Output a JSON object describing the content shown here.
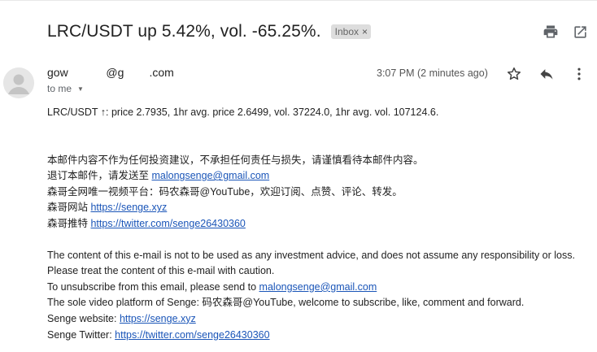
{
  "email": {
    "subject": "LRC/USDT up 5.42%, vol. -65.25%.",
    "label_chip": "Inbox",
    "label_chip_close": "×",
    "sender": "gow            @g        .com",
    "recipient": "to me",
    "timestamp": "3:07 PM (2 minutes ago)",
    "body": {
      "summary": "LRC/USDT ↑: price 2.7935, 1hr avg. price 2.6499, vol. 37224.0, 1hr avg. vol. 107124.6.",
      "cn_disclaimer": "本邮件内容不作为任何投资建议，不承担任何责任与损失，请谨慎看待本邮件内容。",
      "cn_unsub_prefix": "退订本邮件，请发送至 ",
      "cn_unsub_email": "malongsenge@gmail.com",
      "cn_video": "森哥全网唯一视频平台：码农森哥@YouTube，欢迎订阅、点赞、评论、转发。",
      "cn_site_prefix": "森哥网站 ",
      "cn_site_link": "https://senge.xyz",
      "cn_twitter_prefix": "森哥推特 ",
      "cn_twitter_link": "https://twitter.com/senge26430360",
      "en_disclaimer": "The content of this e-mail is not to be used as any investment advice, and does not assume any responsibility or loss. Please treat the content of this e-mail with caution.",
      "en_unsub_prefix": "To unsubscribe from this email, please send to ",
      "en_unsub_email": "malongsenge@gmail.com",
      "en_video": "The sole video platform of Senge: 码农森哥@YouTube, welcome to subscribe, like, comment and forward.",
      "en_site_prefix": "Senge website: ",
      "en_site_link": "https://senge.xyz",
      "en_twitter_prefix": "Senge Twitter: ",
      "en_twitter_link": "https://twitter.com/senge26430360"
    }
  },
  "icons": {
    "print": "printer-icon",
    "popout": "open-in-new-window-icon",
    "star": "star-icon",
    "reply": "reply-icon",
    "more": "more-vertical-icon",
    "avatar": "person-avatar-icon"
  },
  "colors": {
    "link": "#1a55b8",
    "chip_bg": "#dddddd",
    "icon": "#5f6368"
  }
}
